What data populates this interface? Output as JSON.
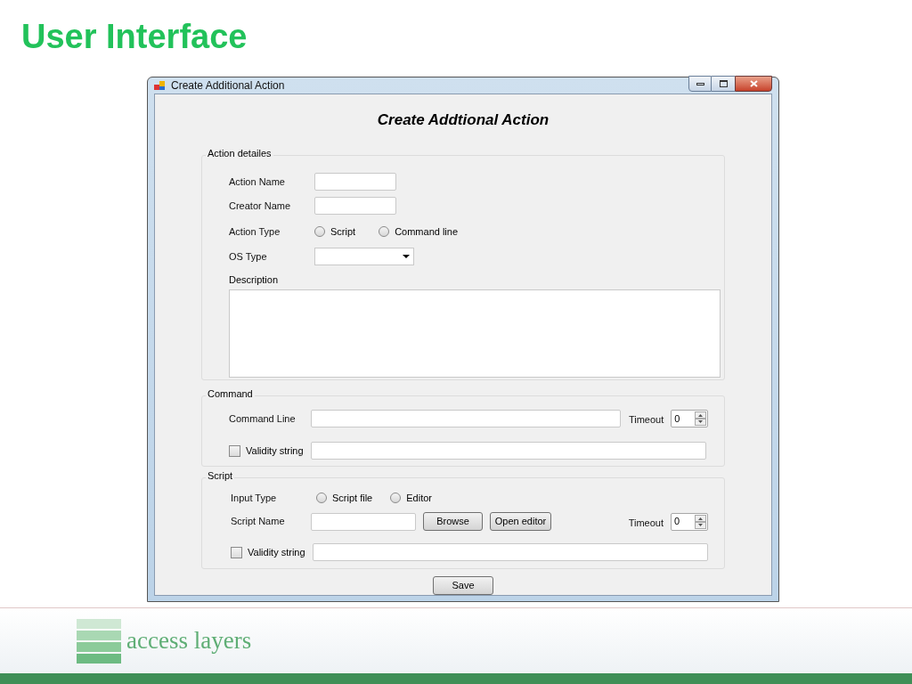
{
  "slide_title": "User Interface",
  "window": {
    "title": "Create Additional Action",
    "heading": "Create Addtional Action"
  },
  "action_details": {
    "legend": "Action detailes",
    "action_name": {
      "label": "Action Name"
    },
    "creator_name": {
      "label": "Creator Name"
    },
    "action_type": {
      "label": "Action Type",
      "options": [
        {
          "label": "Script",
          "selected": false
        },
        {
          "label": "Command line",
          "selected": false
        }
      ]
    },
    "os_type": {
      "label": "OS Type"
    },
    "description": {
      "label": "Description"
    }
  },
  "command": {
    "legend": "Command",
    "command_line": {
      "label": "Command Line"
    },
    "timeout": {
      "label": "Timeout",
      "value": "0"
    },
    "validity": {
      "label": "Validity string",
      "checked": false
    }
  },
  "script": {
    "legend": "Script",
    "input_type": {
      "label": "Input Type",
      "options": [
        {
          "label": "Script file",
          "selected": false
        },
        {
          "label": "Editor",
          "selected": false
        }
      ]
    },
    "script_name": {
      "label": "Script Name"
    },
    "buttons": [
      "Browse",
      "Open editor"
    ],
    "timeout": {
      "label": "Timeout",
      "value": "0"
    },
    "validity": {
      "label": "Validity string",
      "checked": false
    }
  },
  "save_button": "Save",
  "footer": {
    "brand": "access layers"
  }
}
